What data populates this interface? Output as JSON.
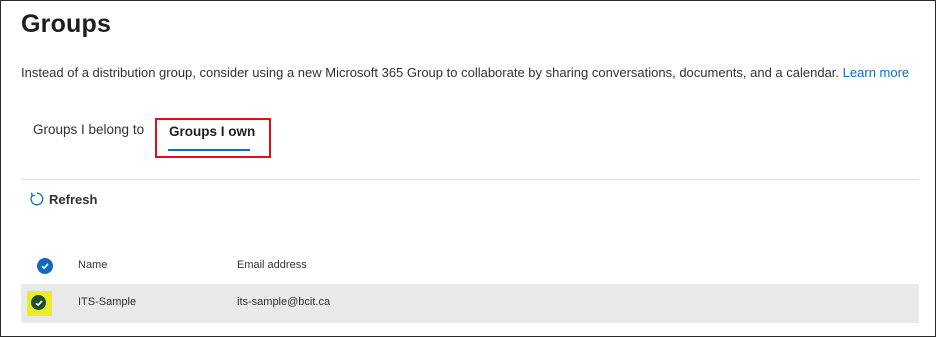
{
  "page": {
    "title": "Groups",
    "description": "Instead of a distribution group, consider using a new Microsoft 365 Group to collaborate by sharing conversations, documents, and a calendar.",
    "learn_more": "Learn more"
  },
  "tabs": [
    {
      "label": "Groups I belong to",
      "selected": false
    },
    {
      "label": "Groups I own",
      "selected": true
    }
  ],
  "toolbar": {
    "refresh_label": "Refresh"
  },
  "table": {
    "columns": [
      "Name",
      "Email address"
    ],
    "rows": [
      {
        "name": "ITS-Sample",
        "email": "its-sample@bcit.ca",
        "selected": true
      }
    ]
  },
  "colors": {
    "accent": "#0f6cbd",
    "highlight_box": "#e0101a",
    "selection_highlight": "#e9ec2e"
  }
}
